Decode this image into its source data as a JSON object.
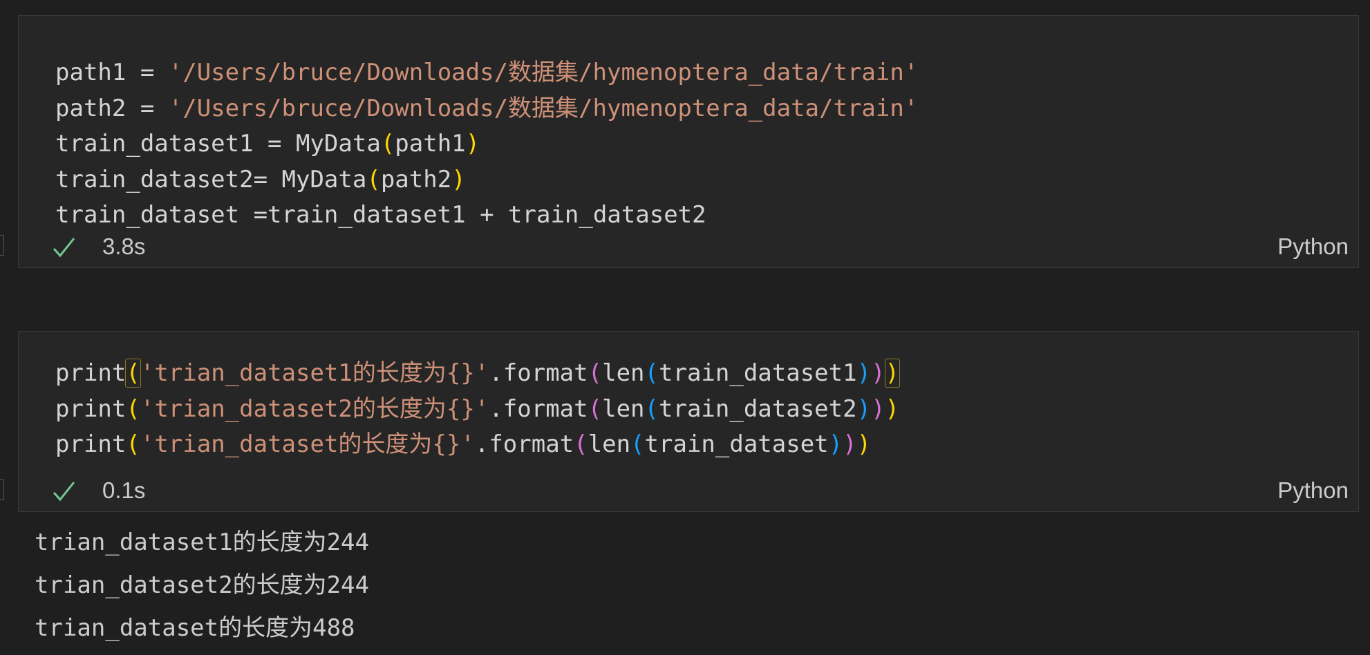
{
  "cells": [
    {
      "code_lines": [
        [
          "path1 = ",
          "'/Users/bruce/Downloads/数据集/hymenoptera_data/train'"
        ],
        [
          "path2 = ",
          "'/Users/bruce/Downloads/数据集/hymenoptera_data/train'"
        ],
        [
          "train_dataset1 = MyData",
          "(",
          "path1",
          ")"
        ],
        [
          "train_dataset2= MyData",
          "(",
          "path2",
          ")"
        ],
        [
          "train_dataset =train_dataset1 + train_dataset2"
        ]
      ],
      "status_icon": "check-icon",
      "exec_time": "3.8s",
      "language": "Python"
    },
    {
      "code_lines": [
        [
          "print",
          "(",
          "'trian_dataset1的长度为{}'",
          ".format",
          "(",
          "len",
          "(",
          "train_dataset1",
          ")",
          ")",
          ")"
        ],
        [
          "print",
          "(",
          "'trian_dataset2的长度为{}'",
          ".format",
          "(",
          "len",
          "(",
          "train_dataset2",
          ")",
          ")",
          ")"
        ],
        [
          "print",
          "(",
          "'trian_dataset的长度为{}'",
          ".format",
          "(",
          "len",
          "(",
          "train_dataset",
          ")",
          ")",
          ")"
        ]
      ],
      "status_icon": "check-icon",
      "exec_time": "0.1s",
      "language": "Python",
      "outputs": [
        "trian_dataset1的长度为244",
        "trian_dataset2的长度为244",
        "trian_dataset的长度为488"
      ]
    }
  ],
  "colors": {
    "background": "#1f1f1f",
    "cell_background": "#262626",
    "string": "#ce9178",
    "bracket_level1": "#ffd700",
    "bracket_level2": "#da70d6",
    "bracket_level3": "#179fff",
    "success": "#73c991"
  }
}
